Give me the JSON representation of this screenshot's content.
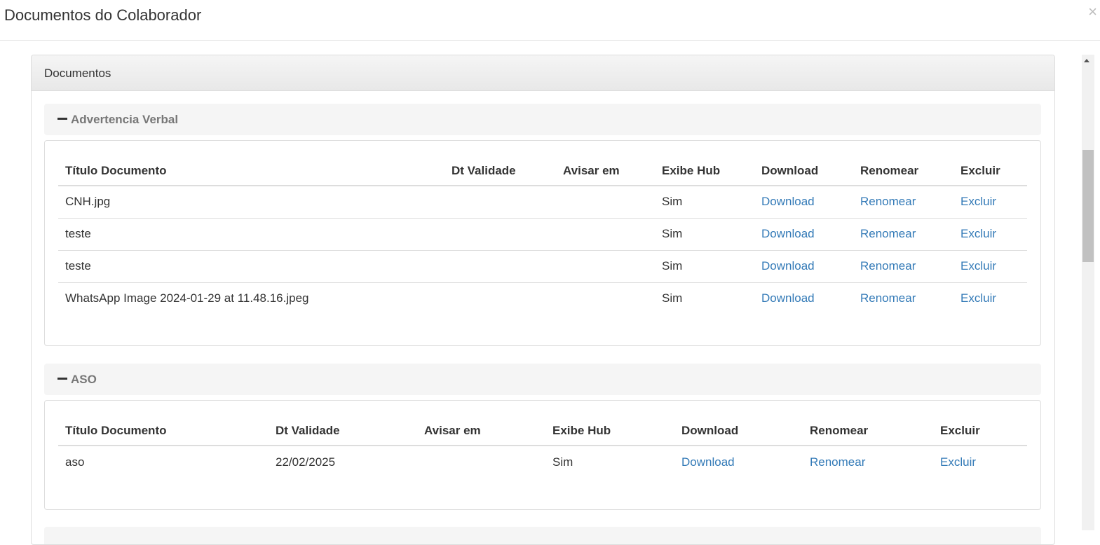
{
  "modal": {
    "title": "Documentos do Colaborador",
    "close_glyph": "×"
  },
  "panel": {
    "title": "Documentos"
  },
  "groups": [
    {
      "title": "Advertencia Verbal",
      "headers": [
        "Título Documento",
        "Dt Validade",
        "Avisar em",
        "Exibe Hub",
        "Download",
        "Renomear",
        "Excluir"
      ],
      "rows": [
        {
          "titulo": "CNH.jpg",
          "validade": "",
          "avisar": "",
          "hub": "Sim",
          "download": "Download",
          "renomear": "Renomear",
          "excluir": "Excluir"
        },
        {
          "titulo": "teste",
          "validade": "",
          "avisar": "",
          "hub": "Sim",
          "download": "Download",
          "renomear": "Renomear",
          "excluir": "Excluir"
        },
        {
          "titulo": "teste",
          "validade": "",
          "avisar": "",
          "hub": "Sim",
          "download": "Download",
          "renomear": "Renomear",
          "excluir": "Excluir"
        },
        {
          "titulo": "WhatsApp Image 2024-01-29 at 11.48.16.jpeg",
          "validade": "",
          "avisar": "",
          "hub": "Sim",
          "download": "Download",
          "renomear": "Renomear",
          "excluir": "Excluir"
        }
      ]
    },
    {
      "title": "ASO",
      "headers": [
        "Título Documento",
        "Dt Validade",
        "Avisar em",
        "Exibe Hub",
        "Download",
        "Renomear",
        "Excluir"
      ],
      "rows": [
        {
          "titulo": "aso",
          "validade": "22/02/2025",
          "avisar": "",
          "hub": "Sim",
          "download": "Download",
          "renomear": "Renomear",
          "excluir": "Excluir"
        }
      ]
    }
  ],
  "colors": {
    "link": "#337ab7",
    "header_bg": "#f5f5f5",
    "border": "#dddddd"
  }
}
